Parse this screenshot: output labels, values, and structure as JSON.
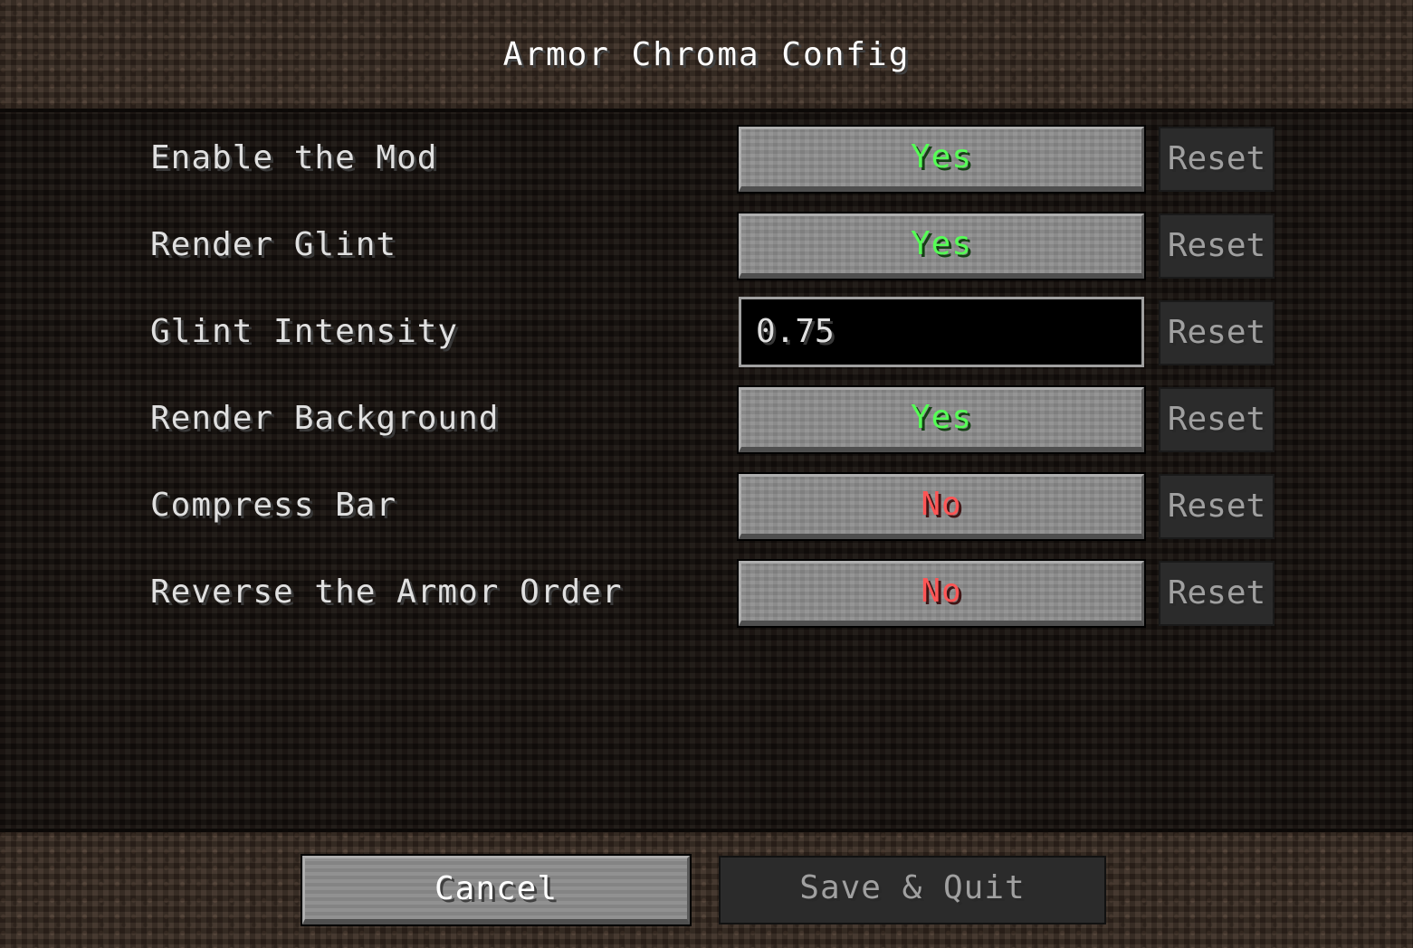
{
  "screen": {
    "title": "Armor Chroma Config"
  },
  "options": [
    {
      "label": "Enable the Mod",
      "type": "toggle",
      "value": "Yes",
      "reset_label": "Reset"
    },
    {
      "label": "Render Glint",
      "type": "toggle",
      "value": "Yes",
      "reset_label": "Reset"
    },
    {
      "label": "Glint Intensity",
      "type": "input",
      "value": "0.75",
      "reset_label": "Reset"
    },
    {
      "label": "Render Background",
      "type": "toggle",
      "value": "Yes",
      "reset_label": "Reset"
    },
    {
      "label": "Compress Bar",
      "type": "toggle",
      "value": "No",
      "reset_label": "Reset"
    },
    {
      "label": "Reverse the Armor Order",
      "type": "toggle",
      "value": "No",
      "reset_label": "Reset"
    }
  ],
  "footer": {
    "cancel_label": "Cancel",
    "save_label": "Save & Quit"
  },
  "colors": {
    "yes": "#55ff55",
    "no": "#ff5555",
    "label_text": "#e0e0e0",
    "disabled_text": "#a0a0a0"
  }
}
